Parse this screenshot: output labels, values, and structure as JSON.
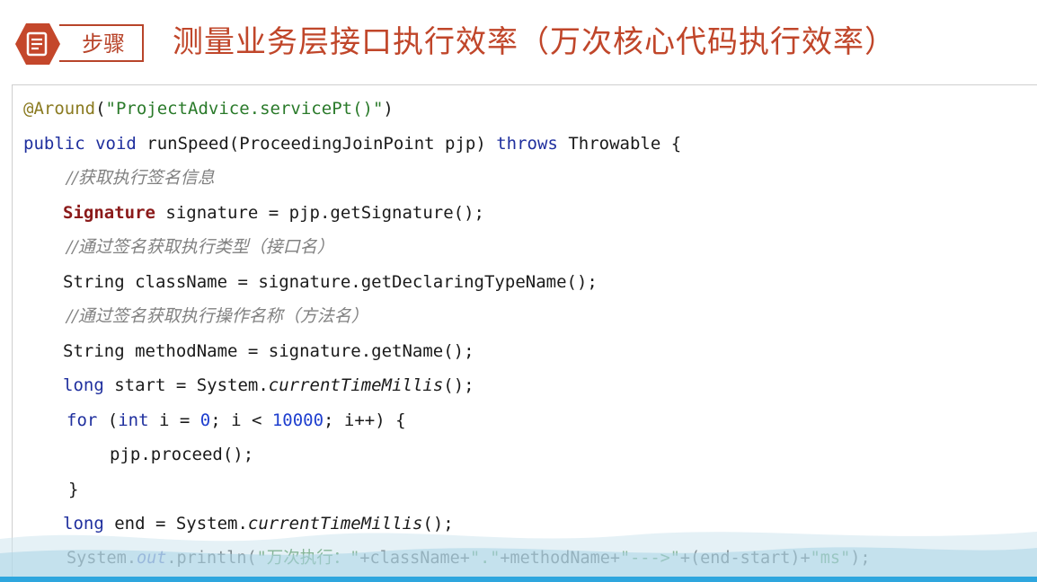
{
  "header": {
    "icon": "document-icon",
    "step_label": "步骤",
    "title": "测量业务层接口执行效率（万次核心代码执行效率）"
  },
  "code": {
    "line1": {
      "annot": "@Around",
      "paren_open": "(",
      "str": "\"ProjectAdvice.servicePt()\"",
      "paren_close": ")"
    },
    "line2": {
      "kw_public": "public",
      "kw_void": "void",
      "rest1": " runSpeed(ProceedingJoinPoint pjp) ",
      "kw_throws": "throws",
      "rest2": " Throwable {"
    },
    "line3": {
      "comment": "//获取执行签名信息"
    },
    "line4": {
      "type": "Signature",
      "rest": " signature = pjp.getSignature();"
    },
    "line5": {
      "comment": "//通过签名获取执行类型（接口名）"
    },
    "line6": {
      "text": "String className = signature.getDeclaringTypeName();"
    },
    "line7": {
      "comment": "//通过签名获取执行操作名称（方法名）"
    },
    "line8": {
      "text": "String methodName = signature.getName();"
    },
    "line9": {
      "kw_long": "long",
      "rest1": " start = System.",
      "ital": "currentTimeMillis",
      "rest2": "();"
    },
    "line10": {
      "kw_for": "for",
      "rest1": " (",
      "kw_int": "int",
      "rest2": " i = ",
      "num0": "0",
      "rest3": "; i < ",
      "num10000": "10000",
      "rest4": "; i++) {"
    },
    "line11": {
      "text": "pjp.proceed();"
    },
    "line12": {
      "text": "}"
    },
    "line13": {
      "kw_long": "long",
      "rest1": " end = System.",
      "ital": "currentTimeMillis",
      "rest2": "();"
    },
    "line14": {
      "pre": "System.",
      "ital": "out",
      "mid1": ".println(",
      "str1": "\"万次执行：\"",
      "mid2": "+className+",
      "str2": "\".\"",
      "mid3": "+methodName+",
      "str3": "\"--->\"",
      "mid4": "+(end-start)+",
      "str4": "\"ms\"",
      "end": ");"
    }
  },
  "colors": {
    "accent": "#c0462a",
    "keyword": "#1f2f9e",
    "string": "#1f7a1f",
    "comment": "#808080",
    "annotation": "#8a7a20",
    "wave": "#a9d3e6"
  }
}
